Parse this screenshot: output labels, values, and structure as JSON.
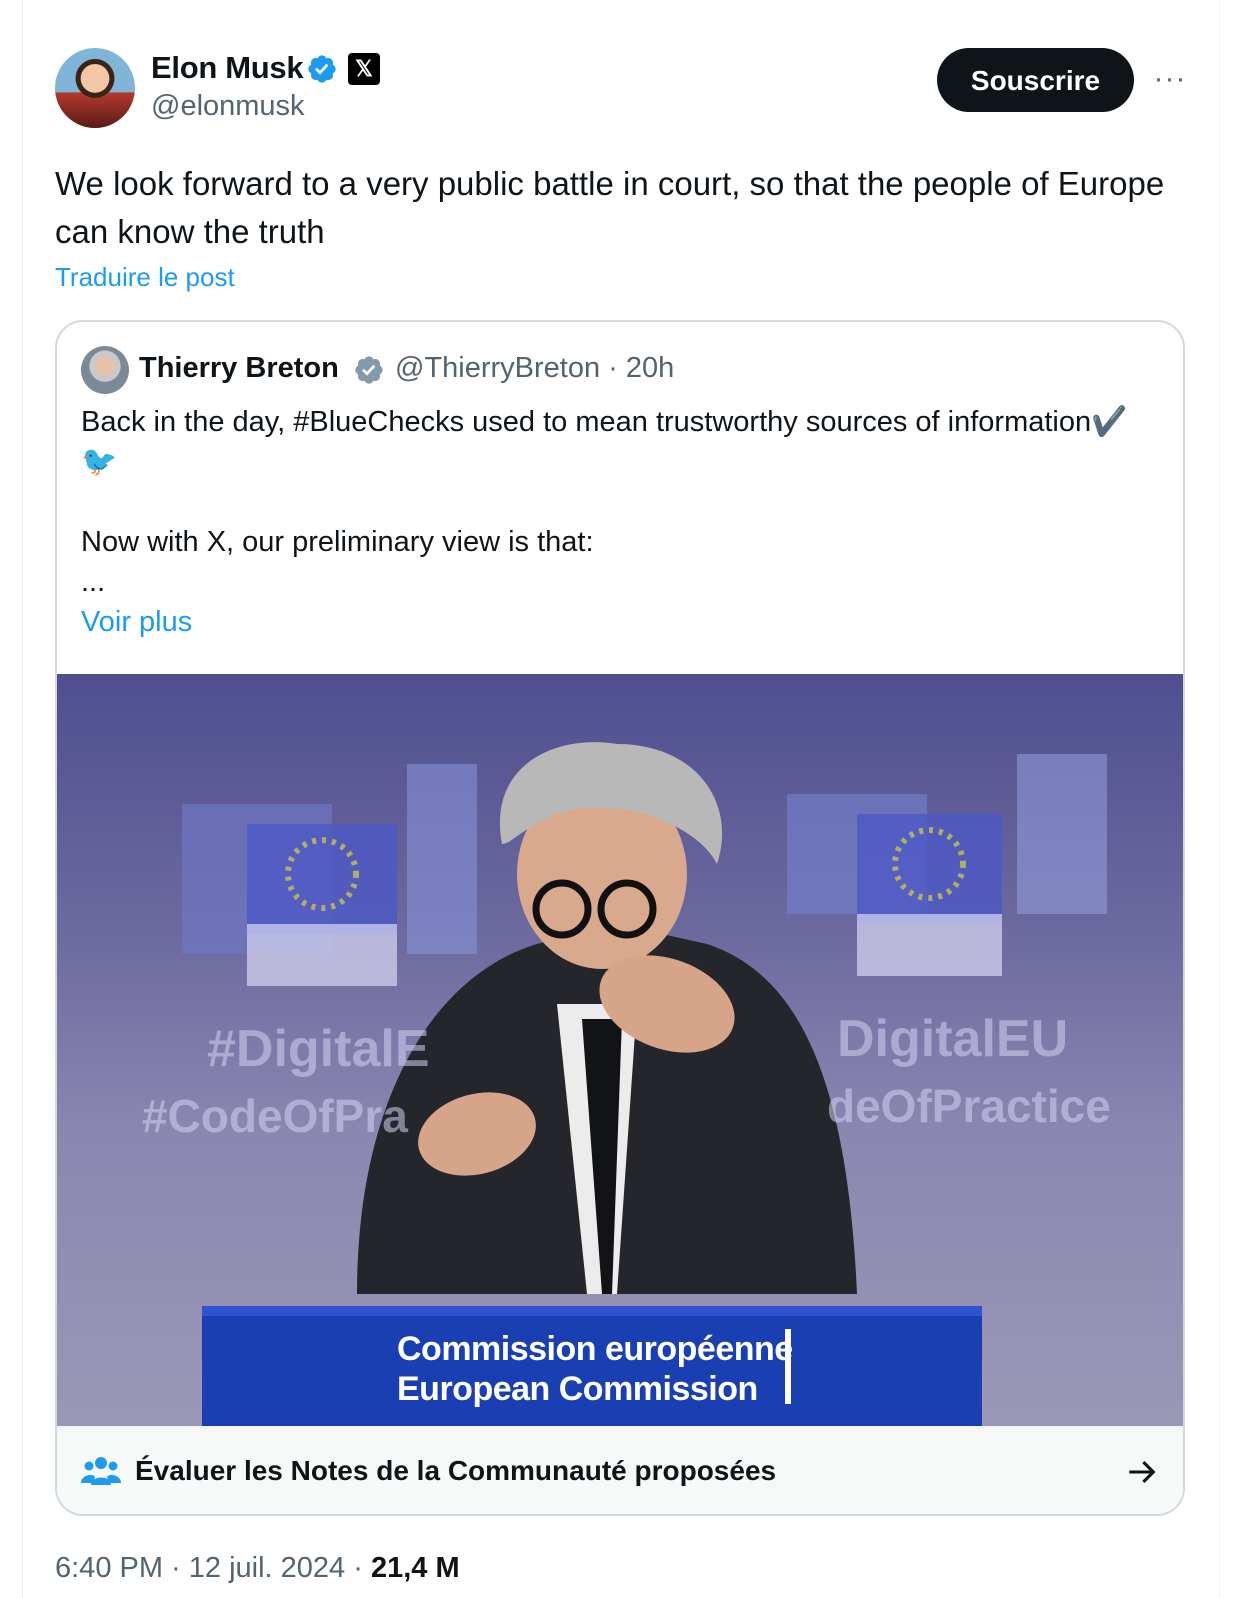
{
  "author": {
    "name": "Elon Musk",
    "handle": "@elonmusk",
    "avatar_icon": "profile-photo",
    "badges": [
      "verified-icon",
      "x-affiliate-icon"
    ],
    "affiliate_glyph": "𝕏"
  },
  "actions": {
    "subscribe_label": "Souscrire",
    "more_glyph": "···"
  },
  "post": {
    "text": "We look forward to a very public battle in court, so that the people of Europe can know the truth",
    "translate_label": "Traduire le post"
  },
  "quoted": {
    "name": "Thierry Breton",
    "handle_time": "@ThierryBreton · 20h",
    "line1": "Back in the day, #BlueChecks used to mean trustworthy sources of information✔️🐦",
    "line2": "Now with X, our preliminary view is that:",
    "line3": "...",
    "more_label": "Voir plus",
    "image": {
      "podium_line1": "Commission européenne",
      "podium_line2": "European Commission",
      "banner_left1": "#DigitalE",
      "banner_left2": "#CodeOfPra",
      "banner_right1": "DigitalEU",
      "banner_right2": "deOfPractice"
    }
  },
  "community_notes": {
    "label": "Évaluer les Notes de la Communauté proposées"
  },
  "footer": {
    "time": "6:40 PM · 12 juil. 2024 · ",
    "views": "21,4 M"
  },
  "colors": {
    "accent": "#1d9bf0",
    "text": "#0f1419",
    "muted": "#536471",
    "border": "#cfd9de"
  }
}
